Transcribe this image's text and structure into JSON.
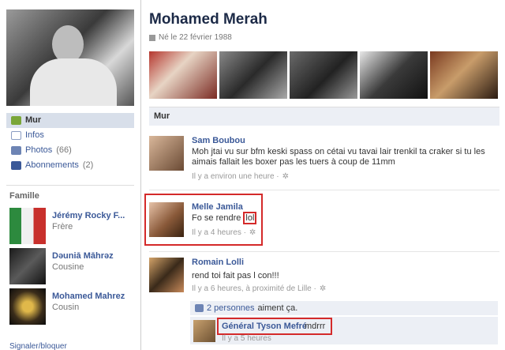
{
  "profile": {
    "name": "Mohamed Merah",
    "birth": "Né le 22 février 1988"
  },
  "nav": {
    "wall": "Mur",
    "info": "Infos",
    "photos": "Photos",
    "photos_count": "(66)",
    "subscriptions": "Abonnements",
    "subscriptions_count": "(2)"
  },
  "family": {
    "title": "Famille",
    "members": [
      {
        "name": "Jérémy Rocky F...",
        "relation": "Frère"
      },
      {
        "name": "Dǝuniā Māhrǝz",
        "relation": "Cousine"
      },
      {
        "name": "Mohamed Mahrez",
        "relation": "Cousin"
      }
    ]
  },
  "report": "Signaler/bloquer",
  "wall": {
    "title": "Mur",
    "posts": [
      {
        "author": "Sam Boubou",
        "text": "Moh jtai vu sur bfm keski spass on cétai vu tavai lair trenkil ta craker si tu les aimais fallait les boxer pas les tuers à coup de 11mm",
        "meta": "Il y a environ une heure ·"
      },
      {
        "author": "Melle Jamila",
        "text_before": "Fo se rendre ",
        "text_highlight": "lol",
        "meta": "Il y a 4 heures ·"
      },
      {
        "author": "Romain Lolli",
        "text": "rend toi fait pas l con!!!",
        "meta": "Il y a 6 heures, à proximité de Lille ·",
        "likes_link": "2 personnes",
        "likes_text": "aiment ça.",
        "reply": {
          "author": "Général Tyson Mefré",
          "text": "mdrrr",
          "meta": "Il y a 5 heures"
        }
      }
    ]
  },
  "icons": {
    "gear": "gear-icon",
    "calendar": "calendar-icon",
    "thumb": "thumbs-up-icon"
  },
  "colors": {
    "link": "#3b5998",
    "highlight": "#d42a2a",
    "nav_active": "#d8dfea"
  }
}
